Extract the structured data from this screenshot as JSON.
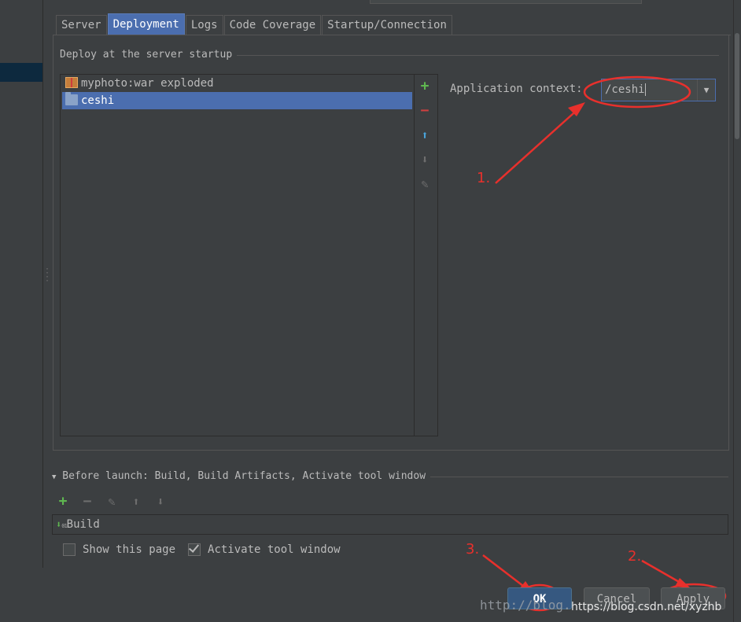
{
  "tabs": [
    {
      "label": "Server"
    },
    {
      "label": "Deployment",
      "active": true
    },
    {
      "label": "Logs"
    },
    {
      "label": "Code Coverage"
    },
    {
      "label": "Startup/Connection"
    }
  ],
  "deploy": {
    "section_title": "Deploy at the server startup",
    "items": [
      {
        "label": "myphoto:war exploded",
        "icon": "artifact-icon",
        "selected": false
      },
      {
        "label": "ceshi",
        "icon": "folder-icon",
        "selected": true
      }
    ],
    "toolbar": [
      {
        "name": "add-icon",
        "glyph": "+",
        "color": "#5fb750"
      },
      {
        "name": "remove-icon",
        "glyph": "−",
        "color": "#d04040"
      },
      {
        "name": "move-up-icon",
        "glyph": "⬆",
        "color": "#4aa3d9"
      },
      {
        "name": "move-down-icon",
        "glyph": "⬇",
        "color": "#6e6e6e"
      },
      {
        "name": "edit-icon",
        "glyph": "✎",
        "color": "#6e6e6e"
      }
    ]
  },
  "context": {
    "label": "Application context:",
    "value": "/ceshi"
  },
  "annotations": {
    "a1": "1.",
    "a2": "2.",
    "a3": "3.",
    "color": "#e8302c"
  },
  "before_launch": {
    "title": "Before launch: Build, Build Artifacts, Activate tool window",
    "toolbar": [
      {
        "name": "add-icon",
        "glyph": "+",
        "color": "#5fb750"
      },
      {
        "name": "remove-icon",
        "glyph": "−",
        "color": "#6e6e6e"
      },
      {
        "name": "edit-icon",
        "glyph": "✎",
        "color": "#6e6e6e"
      },
      {
        "name": "move-up-icon",
        "glyph": "⬆",
        "color": "#6e6e6e"
      },
      {
        "name": "move-down-icon",
        "glyph": "⬇",
        "color": "#6e6e6e"
      }
    ],
    "items": [
      {
        "label": "Build",
        "icon": "build-icon"
      }
    ]
  },
  "options": {
    "show_page": {
      "label": "Show this page",
      "checked": false
    },
    "activate_tool": {
      "label": "Activate tool window",
      "checked": true
    }
  },
  "buttons": {
    "ok": "OK",
    "cancel": "Cancel",
    "apply": "Apply"
  },
  "watermark": {
    "text1": "http://blog.",
    "text2": "https://blog.csdn.net/xyzhb"
  },
  "colors": {
    "background": "#3c3f41",
    "selection": "#4b6eaf",
    "text": "#bbbbbb"
  }
}
